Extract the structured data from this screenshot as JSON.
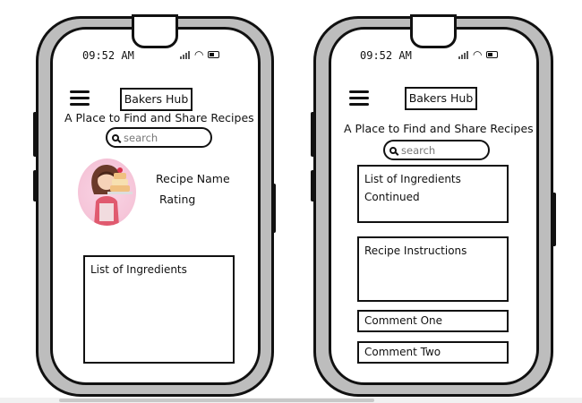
{
  "screens": [
    {
      "status_time": "09:52 AM",
      "brand": "Bakers Hub",
      "tagline": "A Place to Find and Share Recipes",
      "search_placeholder": "search",
      "recipe_name_label": "Recipe Name",
      "rating_label": "Rating",
      "ingredients_box": "List of Ingredients"
    },
    {
      "status_time": "09:52 AM",
      "brand": "Bakers Hub",
      "tagline": "A Place to Find and Share Recipes",
      "search_placeholder": "search",
      "ingredients_continued_line1": "List of Ingredients",
      "ingredients_continued_line2": "Continued",
      "instructions_box": "Recipe Instructions",
      "comment_one": "Comment One",
      "comment_two": "Comment Two"
    }
  ],
  "colors": {
    "frame_fill": "#bdbdbd",
    "outline": "#111111",
    "screen_bg": "#ffffff",
    "avatar_bg": "#f6c7da"
  },
  "icons": [
    "menu-icon",
    "search-icon",
    "signal-icon",
    "wifi-icon",
    "battery-icon"
  ]
}
